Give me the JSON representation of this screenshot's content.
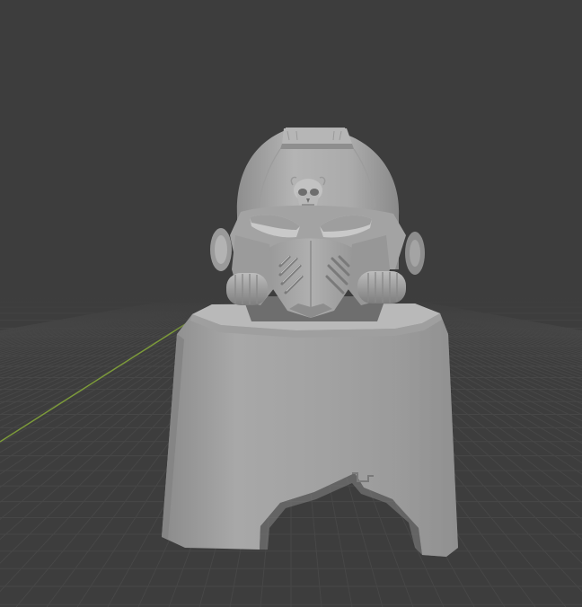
{
  "viewport": {
    "background_color": "#3d3d3d",
    "grid_color": "#474747",
    "grid_major_color": "#4e4e4e",
    "y_axis_color": "#7c9a3a"
  },
  "scene": {
    "object_icon": "helmet-bust-model",
    "object_color": "#a9a9a9"
  }
}
